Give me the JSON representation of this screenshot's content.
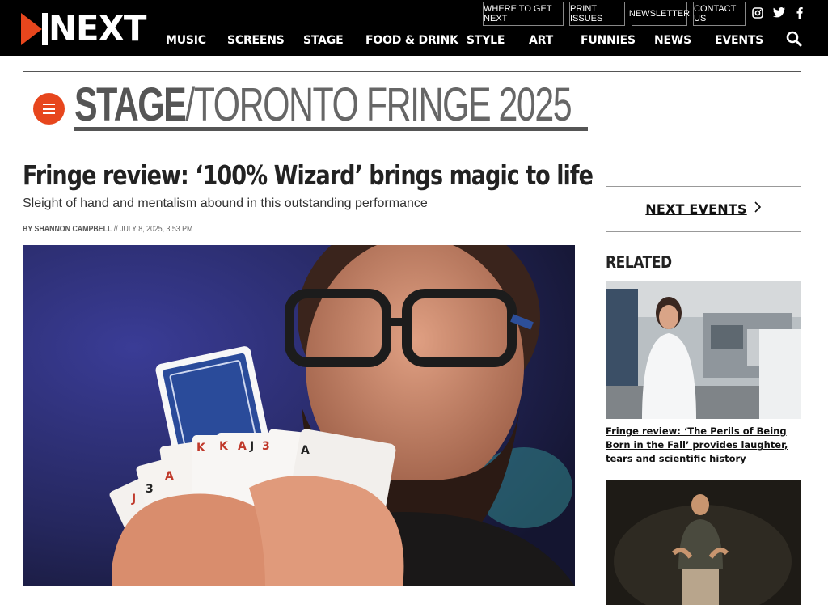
{
  "brand": {
    "logo_text": "NEXT",
    "accent": "#e7461d"
  },
  "utility_nav": [
    {
      "label": "WHERE TO GET NEXT"
    },
    {
      "label": "PRINT ISSUES"
    },
    {
      "label": "NEWSLETTER"
    },
    {
      "label": "CONTACT US"
    }
  ],
  "social": [
    "instagram-icon",
    "twitter-icon",
    "facebook-icon"
  ],
  "main_nav": [
    {
      "label": "MUSIC"
    },
    {
      "label": "SCREENS"
    },
    {
      "label": "STAGE"
    },
    {
      "label": "FOOD & DRINK"
    },
    {
      "label": "STYLE"
    },
    {
      "label": "ART"
    },
    {
      "label": "FUNNIES"
    },
    {
      "label": "NEWS"
    },
    {
      "label": "EVENTS"
    }
  ],
  "section": {
    "primary": "STAGE",
    "secondary": "/TORONTO FRINGE 2025"
  },
  "article": {
    "headline": "Fringe review: ‘100% Wizard’ brings magic to life",
    "subhead": "Sleight of hand and mentalism abound in this outstanding performance",
    "byline_prefix": "BY ",
    "author": "SHANNON CAMPBELL",
    "byline_date": " // JULY 8, 2025, 3:53 PM"
  },
  "sidebar": {
    "next_events_label": "NEXT EVENTS",
    "related_title": "RELATED",
    "related": [
      {
        "title": "Fringe review: ‘The Perils of Being Born in the Fall’ provides laughter, tears and scientific history"
      }
    ]
  }
}
